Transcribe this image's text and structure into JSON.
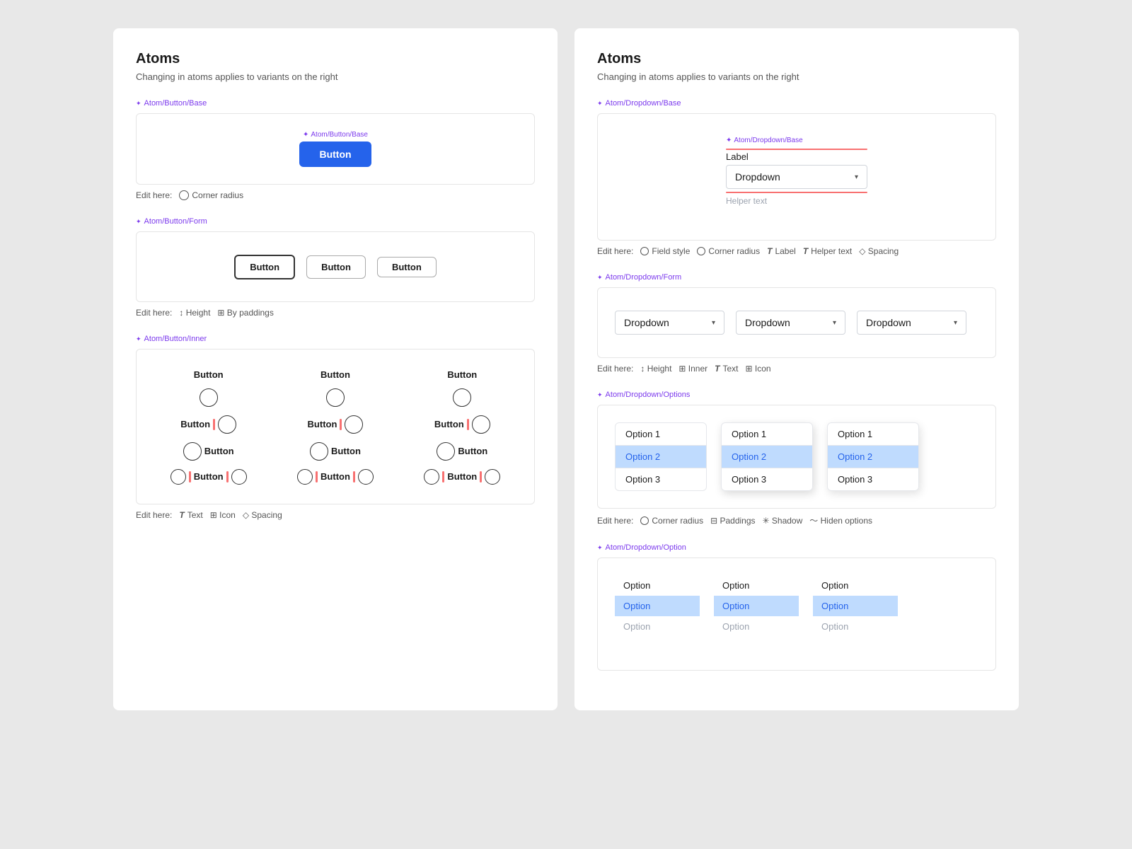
{
  "left_panel": {
    "title": "Atoms",
    "subtitle": "Changing in atoms applies to variants on the right",
    "sections": {
      "base": {
        "atom_label": "Atom/Button/Base",
        "button_label": "Button",
        "edit_label": "Edit here:",
        "edit_items": [
          "Corner radius"
        ]
      },
      "form": {
        "atom_label": "Atom/Button/Form",
        "buttons": [
          "Button",
          "Button",
          "Button"
        ],
        "edit_label": "Edit here:",
        "edit_items": [
          "Height",
          "By paddings"
        ]
      },
      "inner": {
        "atom_label": "Atom/Button/Inner",
        "cols": [
          {
            "label": "Button"
          },
          {
            "label": "Button"
          },
          {
            "label": "Button"
          }
        ],
        "edit_label": "Edit here:",
        "edit_items": [
          "Text",
          "Icon",
          "Spacing"
        ]
      }
    }
  },
  "right_panel": {
    "title": "Atoms",
    "subtitle": "Changing in atoms applies to variants on the right",
    "sections": {
      "base": {
        "atom_label": "Atom/Dropdown/Base",
        "field_label": "Label",
        "dropdown_text": "Dropdown",
        "helper_text": "Helper text",
        "edit_label": "Edit here:",
        "edit_items": [
          "Field style",
          "Corner radius",
          "Label",
          "Helper text",
          "Spacing"
        ]
      },
      "form": {
        "atom_label": "Atom/Dropdown/Form",
        "dropdowns": [
          "Dropdown",
          "Dropdown",
          "Dropdown"
        ],
        "edit_label": "Edit here:",
        "edit_items": [
          "Height",
          "Inner",
          "Text",
          "Icon"
        ]
      },
      "options": {
        "atom_label": "Atom/Dropdown/Options",
        "lists": [
          {
            "items": [
              "Option 1",
              "Option 2",
              "Option 3"
            ],
            "selected": 1,
            "style": "default"
          },
          {
            "items": [
              "Option 1",
              "Option 2",
              "Option 3"
            ],
            "selected": 1,
            "style": "shadow"
          },
          {
            "items": [
              "Option 1",
              "Option 2",
              "Option 3"
            ],
            "selected": 1,
            "style": "bordered"
          }
        ],
        "edit_label": "Edit here:",
        "edit_items": [
          "Corner radius",
          "Paddings",
          "Shadow",
          "Hiden options"
        ]
      },
      "option": {
        "atom_label": "Atom/Dropdown/Option",
        "cols": [
          {
            "items": [
              "Option",
              "Option",
              "Option"
            ]
          },
          {
            "items": [
              "Option",
              "Option",
              "Option"
            ]
          },
          {
            "items": [
              "Option",
              "Option",
              "Option"
            ]
          }
        ],
        "selected_index": 1,
        "col_selected_styles": [
          "default",
          "blue_bg",
          "blue_text"
        ]
      }
    }
  },
  "icons": {
    "radio": "○",
    "T": "T",
    "grid": "⊞",
    "diamond": "◇",
    "chevron_down": "▾",
    "up_down": "↕",
    "sun": "✳",
    "wave": "〜",
    "paddings": "⊟",
    "inner": "⊞"
  }
}
